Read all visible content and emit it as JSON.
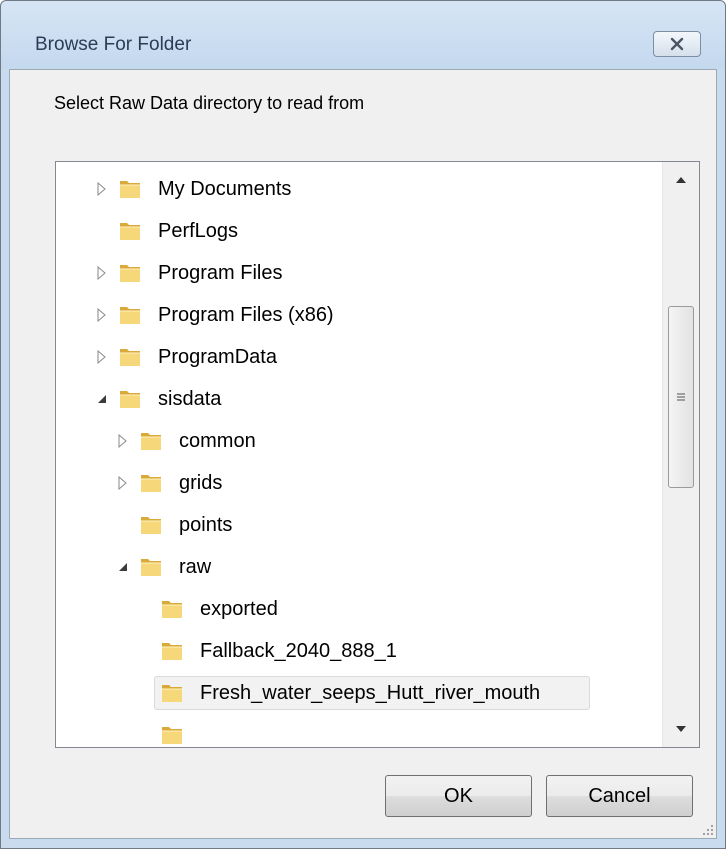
{
  "window": {
    "title": "Browse For Folder",
    "instruction": "Select Raw Data directory to read from"
  },
  "tree": {
    "items": [
      {
        "label": "My Documents",
        "depth": 0,
        "expander": "collapsed",
        "selected": false
      },
      {
        "label": "PerfLogs",
        "depth": 0,
        "expander": "none",
        "selected": false
      },
      {
        "label": "Program Files",
        "depth": 0,
        "expander": "collapsed",
        "selected": false
      },
      {
        "label": "Program Files (x86)",
        "depth": 0,
        "expander": "collapsed",
        "selected": false
      },
      {
        "label": "ProgramData",
        "depth": 0,
        "expander": "collapsed",
        "selected": false
      },
      {
        "label": "sisdata",
        "depth": 0,
        "expander": "expanded",
        "selected": false
      },
      {
        "label": "common",
        "depth": 1,
        "expander": "collapsed",
        "selected": false
      },
      {
        "label": "grids",
        "depth": 1,
        "expander": "collapsed",
        "selected": false
      },
      {
        "label": "points",
        "depth": 1,
        "expander": "none",
        "selected": false
      },
      {
        "label": "raw",
        "depth": 1,
        "expander": "expanded",
        "selected": false
      },
      {
        "label": "exported",
        "depth": 2,
        "expander": "none",
        "selected": false
      },
      {
        "label": "Fallback_2040_888_1",
        "depth": 2,
        "expander": "none",
        "selected": false
      },
      {
        "label": "Fresh_water_seeps_Hutt_river_mouth",
        "depth": 2,
        "expander": "none",
        "selected": true
      },
      {
        "label": "",
        "depth": 2,
        "expander": "none",
        "selected": false
      }
    ]
  },
  "buttons": {
    "ok": "OK",
    "cancel": "Cancel"
  },
  "icons": {
    "close": "close-icon",
    "folder": "folder-icon",
    "expander_collapsed": "triangle-right-icon",
    "expander_expanded": "triangle-down-icon"
  },
  "colors": {
    "folder_light": "#f6d77a",
    "folder_dark": "#d9a93a",
    "frame": "#c8dbef"
  }
}
